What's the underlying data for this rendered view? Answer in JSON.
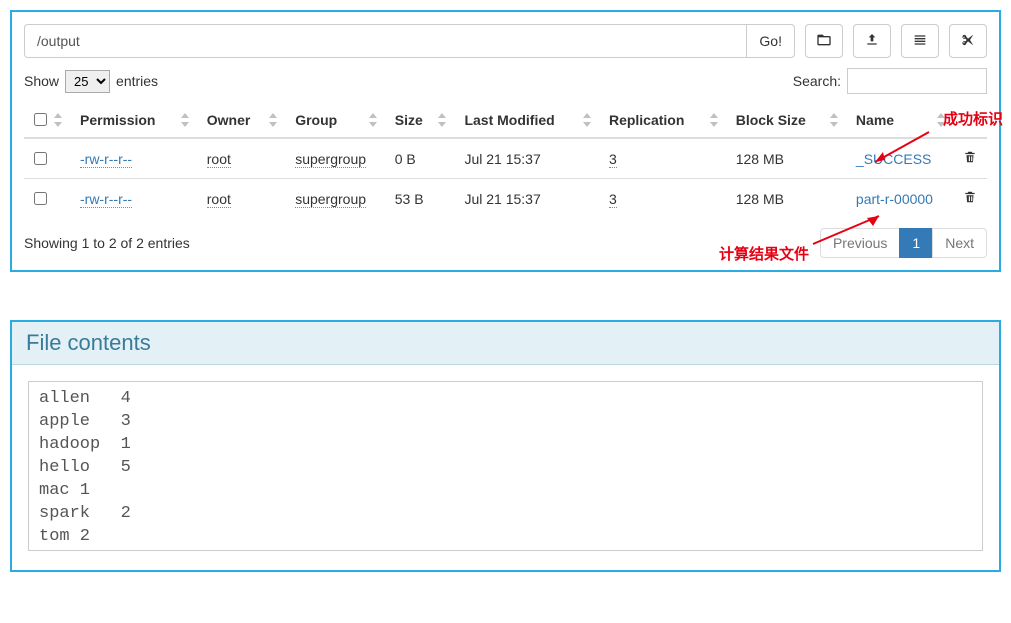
{
  "browser": {
    "path_value": "/output",
    "go_label": "Go!",
    "show_prefix": "Show",
    "show_suffix": "entries",
    "page_size_selected": "25",
    "search_label": "Search:",
    "columns": [
      "",
      "Permission",
      "Owner",
      "Group",
      "Size",
      "Last Modified",
      "Replication",
      "Block Size",
      "Name",
      ""
    ],
    "rows": [
      {
        "permission": "-rw-r--r--",
        "owner": "root",
        "group": "supergroup",
        "size": "0 B",
        "modified": "Jul 21 15:37",
        "replication": "3",
        "block_size": "128 MB",
        "name": "_SUCCESS"
      },
      {
        "permission": "-rw-r--r--",
        "owner": "root",
        "group": "supergroup",
        "size": "53 B",
        "modified": "Jul 21 15:37",
        "replication": "3",
        "block_size": "128 MB",
        "name": "part-r-00000"
      }
    ],
    "info_text": "Showing 1 to 2 of 2 entries",
    "pagination": {
      "prev": "Previous",
      "page1": "1",
      "next": "Next"
    },
    "annotations": {
      "success_marker": "成功标识",
      "result_file": "计算结果文件"
    }
  },
  "file": {
    "header": "File contents",
    "content": "allen   4\napple   3\nhadoop  1\nhello   5\nmac 1\nspark   2\ntom 2"
  }
}
